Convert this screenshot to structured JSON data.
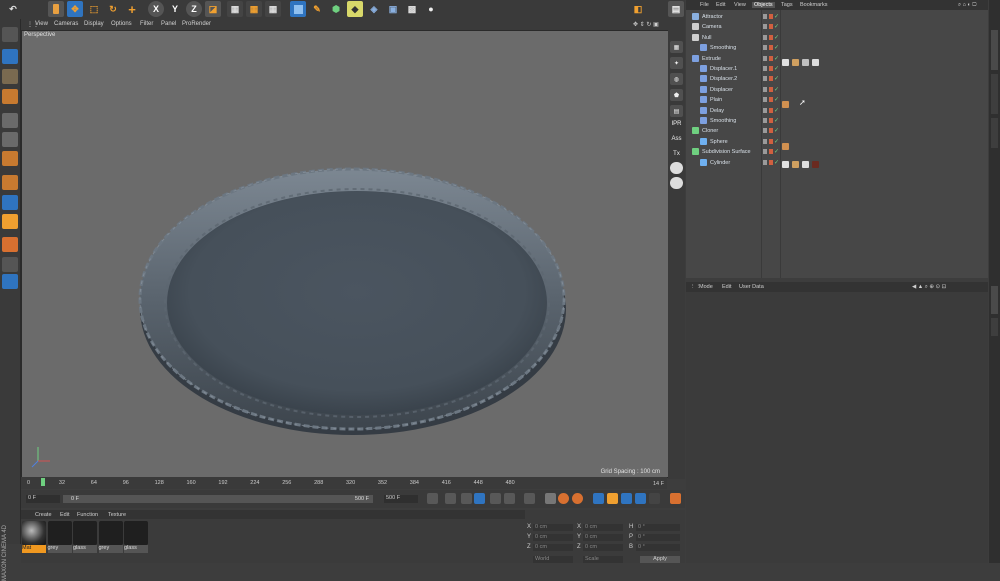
{
  "top_toolbar": {
    "buttons": [
      "undo-icon",
      "live-selection-icon",
      "move-icon",
      "scale-icon",
      "rotate-icon",
      "add-icon",
      "x-axis-icon",
      "y-axis-icon",
      "z-axis-icon",
      "world-coords-icon",
      "render-view-icon",
      "render-picture-icon",
      "render-settings-icon",
      "cube-icon",
      "pen-icon",
      "subdivision-icon",
      "deformer-icon",
      "scene-icon",
      "camera-icon",
      "light-icon"
    ],
    "axis_labels": {
      "x": "X",
      "y": "Y",
      "z": "Z"
    }
  },
  "viewport": {
    "menu": [
      "View",
      "Cameras",
      "Display",
      "Options",
      "Filter",
      "Panel",
      "ProRender"
    ],
    "camera_label": "Perspective",
    "grid_spacing": "Grid Spacing : 100 cm"
  },
  "view_side": {
    "labels": {
      "ipr": "IPR",
      "ass": "Ass",
      "tx": "Tx"
    }
  },
  "objects_manager": {
    "menu": [
      "File",
      "Edit",
      "View",
      "Objects",
      "Tags",
      "Bookmarks"
    ],
    "active_menu": "Objects",
    "rows": [
      {
        "name": "Attractor",
        "indent": 0,
        "icon_color": "#8ab0e0"
      },
      {
        "name": "Camera",
        "indent": 0,
        "icon_color": "#cfcfcf"
      },
      {
        "name": "Null",
        "indent": 0,
        "icon_color": "#cfcfcf"
      },
      {
        "name": "Smoothing",
        "indent": 1,
        "icon_color": "#7da0e0"
      },
      {
        "name": "Extrude",
        "indent": 0,
        "icon_color": "#7da0e0"
      },
      {
        "name": "Displacer.1",
        "indent": 1,
        "icon_color": "#7da0e0"
      },
      {
        "name": "Displacer.2",
        "indent": 1,
        "icon_color": "#7da0e0"
      },
      {
        "name": "Displacer",
        "indent": 1,
        "icon_color": "#7da0e0"
      },
      {
        "name": "Plain",
        "indent": 1,
        "icon_color": "#7da0e0"
      },
      {
        "name": "Delay",
        "indent": 1,
        "icon_color": "#7da0e0"
      },
      {
        "name": "Smoothing",
        "indent": 1,
        "icon_color": "#7da0e0"
      },
      {
        "name": "Cloner",
        "indent": 0,
        "icon_color": "#6fd080"
      },
      {
        "name": "Sphere",
        "indent": 1,
        "icon_color": "#6fb0f0"
      },
      {
        "name": "Subdivision Surface",
        "indent": 0,
        "icon_color": "#6fd080"
      },
      {
        "name": "Cylinder",
        "indent": 1,
        "icon_color": "#6fb0f0"
      }
    ]
  },
  "attribute_manager": {
    "menu": [
      "Mode",
      "Edit",
      "User Data"
    ]
  },
  "timeline": {
    "ticks": [
      "0",
      "32",
      "64",
      "96",
      "128",
      "160",
      "192",
      "224",
      "256",
      "288",
      "320",
      "352",
      "384",
      "416",
      "448",
      "480"
    ],
    "end_frame_label": "14 F",
    "current_frame": 14,
    "max_frame": 500
  },
  "transport": {
    "start_field": "0 F",
    "min_field": "0 F",
    "range_end_field": "500 F",
    "end_field": "500 F"
  },
  "materials": {
    "menu": [
      "Create",
      "Edit",
      "Function",
      "Texture"
    ],
    "items": [
      {
        "label": "Mat",
        "selected": true
      },
      {
        "label": "grey",
        "selected": false
      },
      {
        "label": "glass",
        "selected": false
      },
      {
        "label": "grey",
        "selected": false
      },
      {
        "label": "glass",
        "selected": false
      }
    ]
  },
  "coordinates": {
    "rows": [
      {
        "axis": "X",
        "pos": "0 cm",
        "size_axis": "X",
        "size": "0 cm",
        "rot_axis": "H",
        "rot": "0 °"
      },
      {
        "axis": "Y",
        "pos": "0 cm",
        "size_axis": "Y",
        "size": "0 cm",
        "rot_axis": "P",
        "rot": "0 °"
      },
      {
        "axis": "Z",
        "pos": "0 cm",
        "size_axis": "Z",
        "size": "0 cm",
        "rot_axis": "B",
        "rot": "0 °"
      }
    ],
    "mode_select": "World",
    "scale_select": "Scale",
    "apply_label": "Apply"
  },
  "branding": "MAXON CINEMA 4D",
  "colors": {
    "accent": "#f09820",
    "selection": "#2f74c0"
  }
}
